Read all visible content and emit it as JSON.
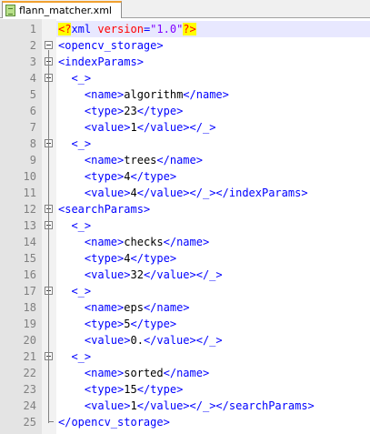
{
  "tab": {
    "label": "flann_matcher.xml"
  },
  "lines": [
    {
      "n": "1",
      "indent": "",
      "parts": [
        [
          "pi",
          "<?"
        ],
        [
          "t",
          "xml "
        ],
        [
          "a",
          "version"
        ],
        [
          "t",
          "="
        ],
        [
          "v",
          "\"1.0\""
        ],
        [
          "pi",
          "?>"
        ]
      ]
    },
    {
      "n": "2",
      "indent": "",
      "parts": [
        [
          "t",
          "<opencv_storage>"
        ]
      ]
    },
    {
      "n": "3",
      "indent": "",
      "parts": [
        [
          "t",
          "<indexParams>"
        ]
      ]
    },
    {
      "n": "4",
      "indent": "  ",
      "parts": [
        [
          "t",
          "<_>"
        ]
      ]
    },
    {
      "n": "5",
      "indent": "    ",
      "parts": [
        [
          "t",
          "<name>"
        ],
        [
          "x",
          "algorithm"
        ],
        [
          "t",
          "</name>"
        ]
      ]
    },
    {
      "n": "6",
      "indent": "    ",
      "parts": [
        [
          "t",
          "<type>"
        ],
        [
          "x",
          "23"
        ],
        [
          "t",
          "</type>"
        ]
      ]
    },
    {
      "n": "7",
      "indent": "    ",
      "parts": [
        [
          "t",
          "<value>"
        ],
        [
          "x",
          "1"
        ],
        [
          "t",
          "</value></_>"
        ]
      ]
    },
    {
      "n": "8",
      "indent": "  ",
      "parts": [
        [
          "t",
          "<_>"
        ]
      ]
    },
    {
      "n": "9",
      "indent": "    ",
      "parts": [
        [
          "t",
          "<name>"
        ],
        [
          "x",
          "trees"
        ],
        [
          "t",
          "</name>"
        ]
      ]
    },
    {
      "n": "10",
      "indent": "    ",
      "parts": [
        [
          "t",
          "<type>"
        ],
        [
          "x",
          "4"
        ],
        [
          "t",
          "</type>"
        ]
      ]
    },
    {
      "n": "11",
      "indent": "    ",
      "parts": [
        [
          "t",
          "<value>"
        ],
        [
          "x",
          "4"
        ],
        [
          "t",
          "</value></_></indexParams>"
        ]
      ]
    },
    {
      "n": "12",
      "indent": "",
      "parts": [
        [
          "t",
          "<searchParams>"
        ]
      ]
    },
    {
      "n": "13",
      "indent": "  ",
      "parts": [
        [
          "t",
          "<_>"
        ]
      ]
    },
    {
      "n": "14",
      "indent": "    ",
      "parts": [
        [
          "t",
          "<name>"
        ],
        [
          "x",
          "checks"
        ],
        [
          "t",
          "</name>"
        ]
      ]
    },
    {
      "n": "15",
      "indent": "    ",
      "parts": [
        [
          "t",
          "<type>"
        ],
        [
          "x",
          "4"
        ],
        [
          "t",
          "</type>"
        ]
      ]
    },
    {
      "n": "16",
      "indent": "    ",
      "parts": [
        [
          "t",
          "<value>"
        ],
        [
          "x",
          "32"
        ],
        [
          "t",
          "</value></_>"
        ]
      ]
    },
    {
      "n": "17",
      "indent": "  ",
      "parts": [
        [
          "t",
          "<_>"
        ]
      ]
    },
    {
      "n": "18",
      "indent": "    ",
      "parts": [
        [
          "t",
          "<name>"
        ],
        [
          "x",
          "eps"
        ],
        [
          "t",
          "</name>"
        ]
      ]
    },
    {
      "n": "19",
      "indent": "    ",
      "parts": [
        [
          "t",
          "<type>"
        ],
        [
          "x",
          "5"
        ],
        [
          "t",
          "</type>"
        ]
      ]
    },
    {
      "n": "20",
      "indent": "    ",
      "parts": [
        [
          "t",
          "<value>"
        ],
        [
          "x",
          "0."
        ],
        [
          "t",
          "</value></_>"
        ]
      ]
    },
    {
      "n": "21",
      "indent": "  ",
      "parts": [
        [
          "t",
          "<_>"
        ]
      ]
    },
    {
      "n": "22",
      "indent": "    ",
      "parts": [
        [
          "t",
          "<name>"
        ],
        [
          "x",
          "sorted"
        ],
        [
          "t",
          "</name>"
        ]
      ]
    },
    {
      "n": "23",
      "indent": "    ",
      "parts": [
        [
          "t",
          "<type>"
        ],
        [
          "x",
          "15"
        ],
        [
          "t",
          "</type>"
        ]
      ]
    },
    {
      "n": "24",
      "indent": "    ",
      "parts": [
        [
          "t",
          "<value>"
        ],
        [
          "x",
          "1"
        ],
        [
          "t",
          "</value></_></searchParams>"
        ]
      ]
    },
    {
      "n": "25",
      "indent": "",
      "parts": [
        [
          "t",
          "</opencv_storage>"
        ]
      ]
    }
  ],
  "fold_markers": [
    "2",
    "3",
    "4",
    "8",
    "12",
    "13",
    "17",
    "21"
  ],
  "colors": {
    "tag": "#0000ff",
    "attribute": "#ff0000",
    "attr_value": "#8000ff",
    "pi_highlight": "#ffff00",
    "current_line": "#e8e8ff"
  }
}
